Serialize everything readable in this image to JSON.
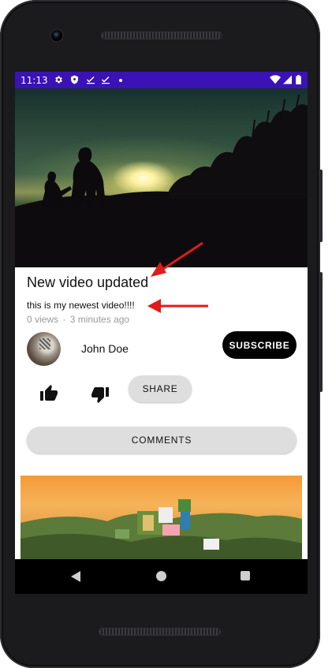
{
  "status_bar": {
    "time": "11:13",
    "left_icons": [
      "gear-icon",
      "shield-icon",
      "check-icon",
      "check-icon",
      "dot-icon"
    ],
    "right_icons": [
      "wifi-icon",
      "signal-icon",
      "battery-icon"
    ],
    "color": "#3a12b6"
  },
  "video": {
    "title": "New video updated",
    "description": "this is my newest video!!!!",
    "views": "0 views",
    "separator": "·",
    "uploaded": "3 minutes ago"
  },
  "channel": {
    "name": "John Doe",
    "subscribe_label": "SUBSCRIBE"
  },
  "actions": {
    "like_icon": "thumbs-up-icon",
    "dislike_icon": "thumbs-down-icon",
    "share_label": "SHARE",
    "comments_label": "COMMENTS"
  },
  "navigation": {
    "back_icon": "back-icon",
    "home_icon": "home-icon",
    "recents_icon": "recents-icon"
  },
  "colors": {
    "subscribe_bg": "#000000",
    "pill_bg": "#dedede",
    "annotation_arrow": "#e01b1b"
  }
}
